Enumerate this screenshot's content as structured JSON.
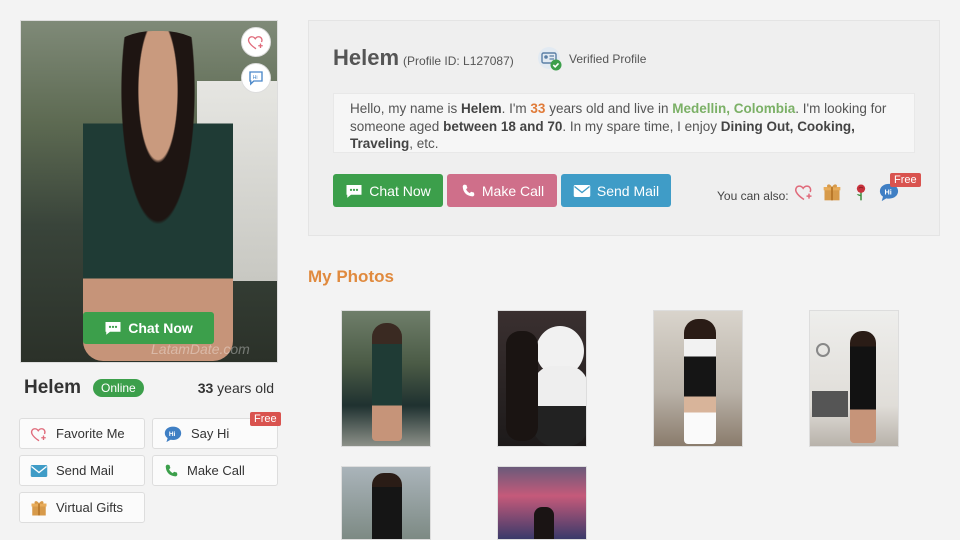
{
  "profile": {
    "name": "Helem",
    "profile_id_text": "(Profile ID: L127087)",
    "verified_label": "Verified Profile",
    "online_label": "Online",
    "age_number": "33",
    "age_suffix": " years old",
    "watermark": "LatamDate.com"
  },
  "intro": {
    "p1": "Hello, my name is ",
    "name": "Helem",
    "p2": ". I'm ",
    "age": "33",
    "p3": " years old and live in ",
    "location": "Medellin, Colombia",
    "p4": ". I'm looking for someone aged ",
    "age_range": "between 18 and 70",
    "p5": ". In my spare time, I enjoy ",
    "hobbies": "Dining Out, Cooking, Traveling",
    "p6": ", etc."
  },
  "actions": {
    "chat_now": "Chat Now",
    "make_call": "Make Call",
    "send_mail": "Send Mail",
    "you_can_also": "You can also:",
    "free": "Free",
    "hi": "Hi"
  },
  "left_buttons": {
    "favorite_me": "Favorite Me",
    "say_hi": "Say Hi",
    "send_mail": "Send Mail",
    "make_call": "Make Call",
    "virtual_gifts": "Virtual Gifts",
    "free": "Free",
    "hi": "Hi"
  },
  "photos_heading": "My Photos",
  "colors": {
    "green": "#3c9f4b",
    "pink": "#cf6f8a",
    "blue": "#3f9cc7",
    "orange": "#e08a3e",
    "red_badge": "#d9534f"
  },
  "icons": [
    "heart-plus-icon",
    "chat-hi-icon",
    "chat-bubble-icon",
    "phone-icon",
    "envelope-icon",
    "gift-icon",
    "rose-icon",
    "verified-id-icon"
  ]
}
